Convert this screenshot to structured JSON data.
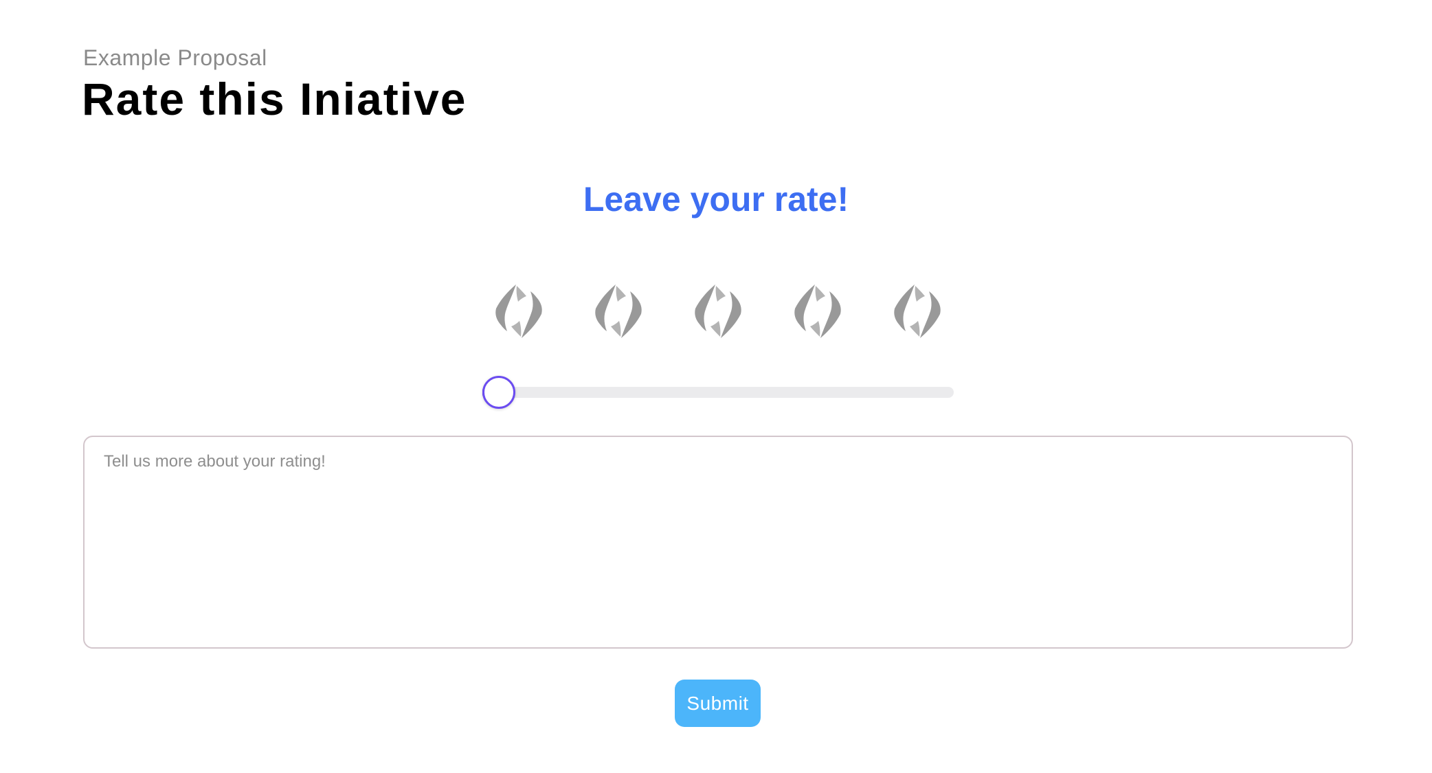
{
  "header": {
    "subtitle": "Example Proposal",
    "title": "Rate this Iniative"
  },
  "rating": {
    "heading": "Leave your rate!",
    "icon_name": "ens-diamond-icon",
    "icon_count": 5,
    "icon_color": "#999999",
    "selected_value": 0,
    "slider_min": 0,
    "slider_max": 5,
    "accent_color": "#6b4cf0",
    "heading_color": "#3d6ef2"
  },
  "comment": {
    "placeholder": "Tell us more about your rating!",
    "value": ""
  },
  "actions": {
    "submit_label": "Submit",
    "submit_color": "#4cb5fa"
  }
}
